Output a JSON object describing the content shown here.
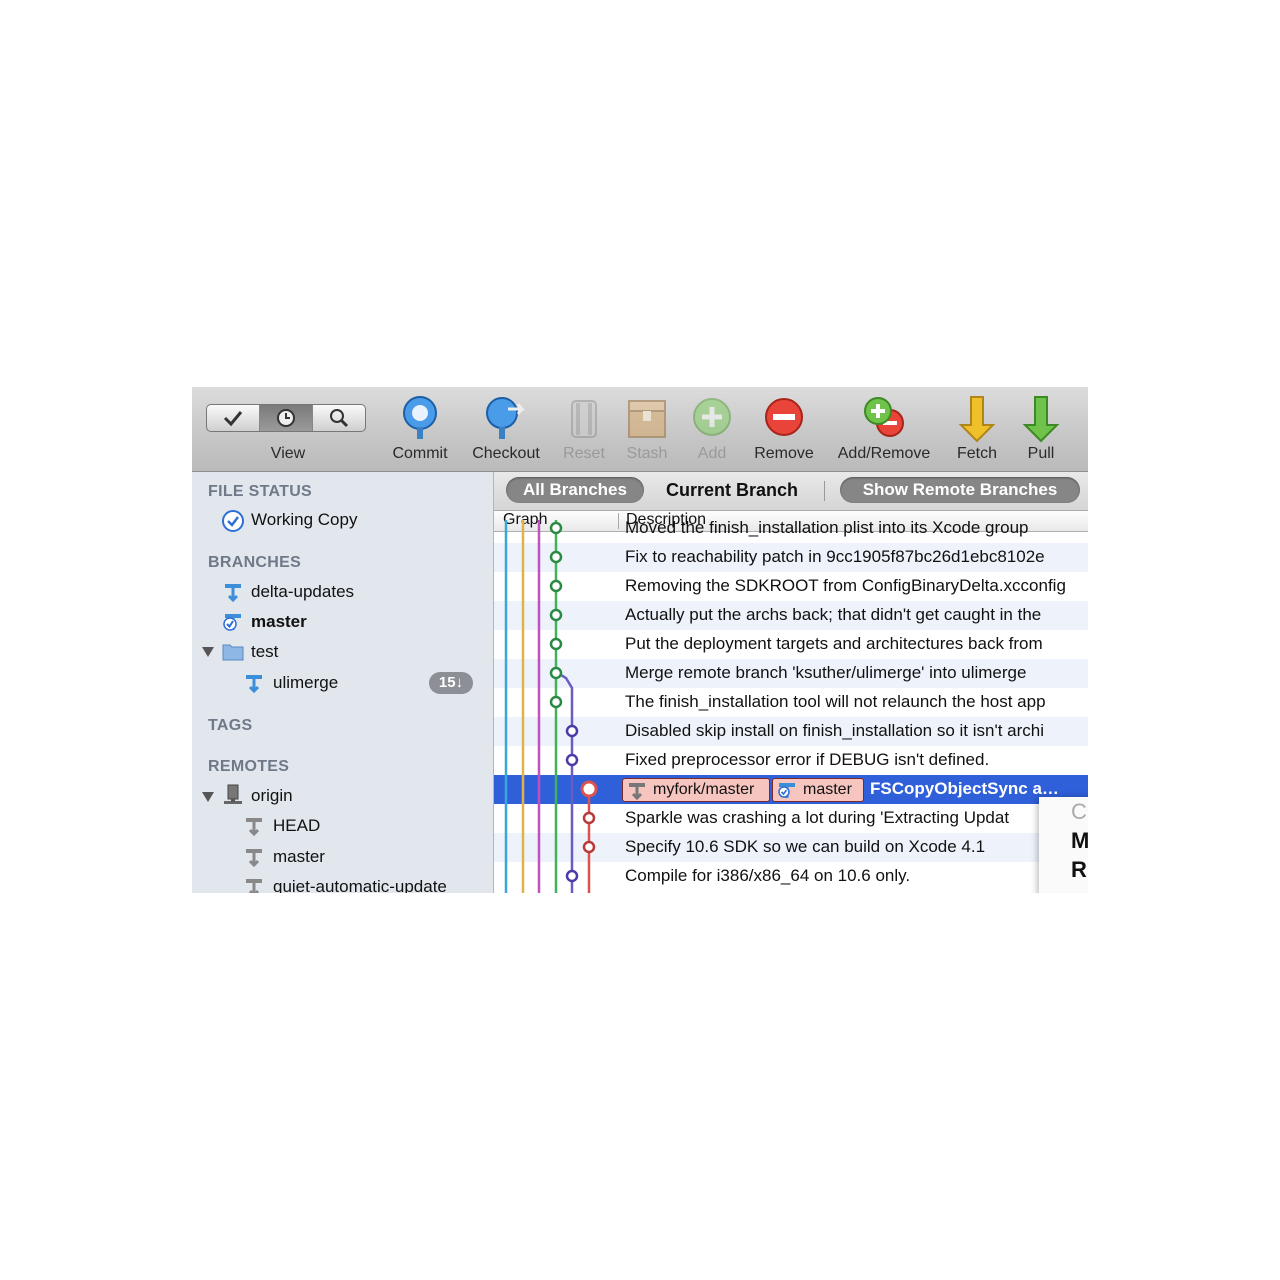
{
  "toolbar": {
    "view_label": "View",
    "buttons": [
      {
        "label": "Commit",
        "icon": "commit-icon",
        "enabled": true
      },
      {
        "label": "Checkout",
        "icon": "checkout-icon",
        "enabled": true
      },
      {
        "label": "Reset",
        "icon": "reset-icon",
        "enabled": false
      },
      {
        "label": "Stash",
        "icon": "stash-icon",
        "enabled": false
      },
      {
        "label": "Add",
        "icon": "add-icon",
        "enabled": false
      },
      {
        "label": "Remove",
        "icon": "remove-icon",
        "enabled": true
      },
      {
        "label": "Add/Remove",
        "icon": "add-remove-icon",
        "enabled": true
      },
      {
        "label": "Fetch",
        "icon": "fetch-icon",
        "enabled": true
      },
      {
        "label": "Pull",
        "icon": "pull-icon",
        "enabled": true
      }
    ]
  },
  "sidebar": {
    "file_status": "FILE STATUS",
    "working_copy": "Working Copy",
    "branches": "BRANCHES",
    "branch_delta": "delta-updates",
    "branch_master": "master",
    "folder_test": "test",
    "branch_ulimerge": "ulimerge",
    "ulimerge_badge": "15↓",
    "tags": "TAGS",
    "remotes": "REMOTES",
    "remote_origin": "origin",
    "remote_head": "HEAD",
    "remote_master": "master",
    "remote_quiet": "quiet-automatic-update"
  },
  "filter": {
    "all": "All Branches",
    "current": "Current Branch",
    "remote": "Show Remote Branches"
  },
  "columns": {
    "graph": "Graph",
    "description": "Description"
  },
  "commits": [
    {
      "text": "Moved the finish_installation plist into its Xcode group"
    },
    {
      "text": "Fix to reachability patch in 9cc1905f87bc26d1ebc8102e"
    },
    {
      "text": "Removing the SDKROOT from ConfigBinaryDelta.xcconfig"
    },
    {
      "text": "Actually put the archs back; that didn't get caught in the"
    },
    {
      "text": "Put the deployment targets and architectures back from"
    },
    {
      "text": "Merge remote branch 'ksuther/ulimerge' into ulimerge"
    },
    {
      "text": "The finish_installation tool will not relaunch the host app"
    },
    {
      "text": "Disabled skip install on finish_installation so it isn't archi"
    },
    {
      "text": "Fixed preprocessor error if DEBUG isn't defined."
    },
    {
      "text": "FSCopyObjectSync a…",
      "tags": [
        "myfork/master",
        "master"
      ]
    },
    {
      "text": "Sparkle was crashing a lot during 'Extracting Updat"
    },
    {
      "text": "Specify 10.6 SDK so we can build on Xcode 4.1"
    },
    {
      "text": "Compile for i386/x86_64 on 10.6 only."
    }
  ],
  "popup": {
    "line1": "C",
    "line2": "M",
    "line3": "R"
  },
  "colors": {
    "selection": "#2f5fd9",
    "graph_lines": [
      "#3aa7d8",
      "#e0b34a",
      "#c052c0",
      "#3fb25a",
      "#6b5bc4",
      "#d9534f"
    ]
  }
}
